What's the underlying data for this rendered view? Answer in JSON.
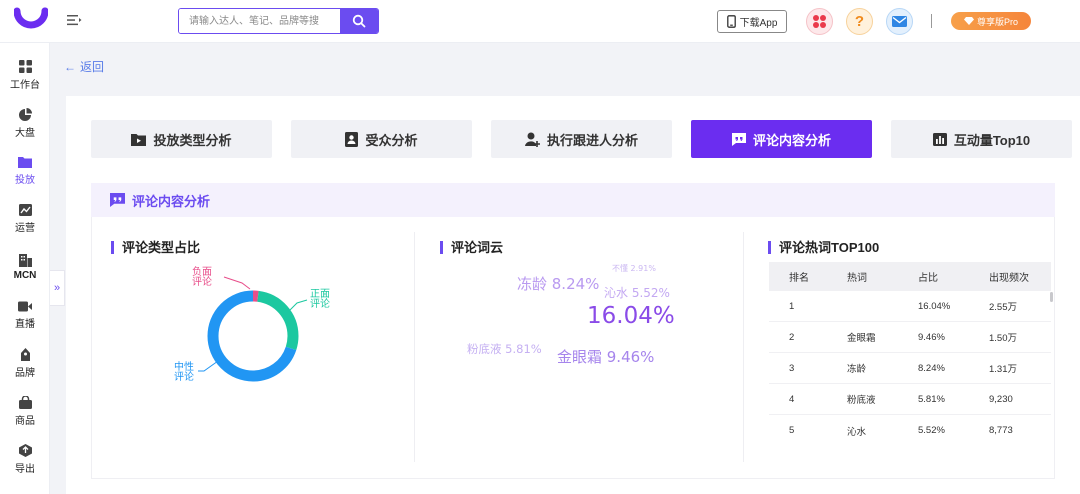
{
  "header": {
    "search_placeholder": "请输入达人、笔记、品牌等搜",
    "download_label": "下载App",
    "pro_label": "尊享版Pro"
  },
  "sidebar": {
    "items": [
      {
        "label": "工作台",
        "icon": "grid-icon"
      },
      {
        "label": "大盘",
        "icon": "pie-icon"
      },
      {
        "label": "投放",
        "icon": "folder-icon",
        "active": true
      },
      {
        "label": "运营",
        "icon": "chart-icon"
      },
      {
        "label": "MCN",
        "icon": "building-icon"
      },
      {
        "label": "直播",
        "icon": "video-icon"
      },
      {
        "label": "品牌",
        "icon": "brand-icon"
      },
      {
        "label": "商品",
        "icon": "bag-icon"
      },
      {
        "label": "导出",
        "icon": "export-icon"
      }
    ],
    "collapse_glyph": "»"
  },
  "back_label": "返回",
  "tabs": [
    {
      "label": "投放类型分析",
      "icon": "folder-play-icon"
    },
    {
      "label": "受众分析",
      "icon": "id-card-icon"
    },
    {
      "label": "执行跟进人分析",
      "icon": "person-add-icon"
    },
    {
      "label": "评论内容分析",
      "icon": "comment-icon",
      "active": true
    },
    {
      "label": "互动量Top10",
      "icon": "bar-chart-icon"
    }
  ],
  "section_title": "评论内容分析",
  "panels": {
    "type_ratio": {
      "title": "评论类型占比",
      "labels": {
        "negative": [
          "负面",
          "评论"
        ],
        "positive": [
          "正面",
          "评论"
        ],
        "neutral": [
          "中性",
          "评论"
        ]
      }
    },
    "word_cloud": {
      "title": "评论词云",
      "words": [
        {
          "text": "冻龄 8.24%"
        },
        {
          "text": "不懂 2.91%"
        },
        {
          "text": "沁水 5.52%"
        },
        {
          "text": "16.04%"
        },
        {
          "text": "粉底液 5.81%"
        },
        {
          "text": "金眼霜 9.46%"
        }
      ]
    },
    "hot_words": {
      "title": "评论热词TOP100",
      "columns": [
        "排名",
        "热词",
        "占比",
        "出现频次"
      ],
      "rows": [
        {
          "rank": "1",
          "word": "",
          "ratio": "16.04%",
          "freq": "2.55万"
        },
        {
          "rank": "2",
          "word": "金眼霜",
          "ratio": "9.46%",
          "freq": "1.50万"
        },
        {
          "rank": "3",
          "word": "冻龄",
          "ratio": "8.24%",
          "freq": "1.31万"
        },
        {
          "rank": "4",
          "word": "粉底液",
          "ratio": "5.81%",
          "freq": "9,230"
        },
        {
          "rank": "5",
          "word": "沁水",
          "ratio": "5.52%",
          "freq": "8,773"
        }
      ]
    }
  },
  "chart_data": {
    "type": "pie",
    "title": "评论类型占比",
    "categories": [
      "负面评论",
      "正面评论",
      "中性评论"
    ],
    "values": [
      2,
      28,
      70
    ],
    "colors": [
      "#e84e8a",
      "#1cc8a0",
      "#2196f3"
    ]
  },
  "colors": {
    "accent": "#6b4cf0",
    "active_tab": "#6b2df0",
    "pro": "#f5853b"
  }
}
